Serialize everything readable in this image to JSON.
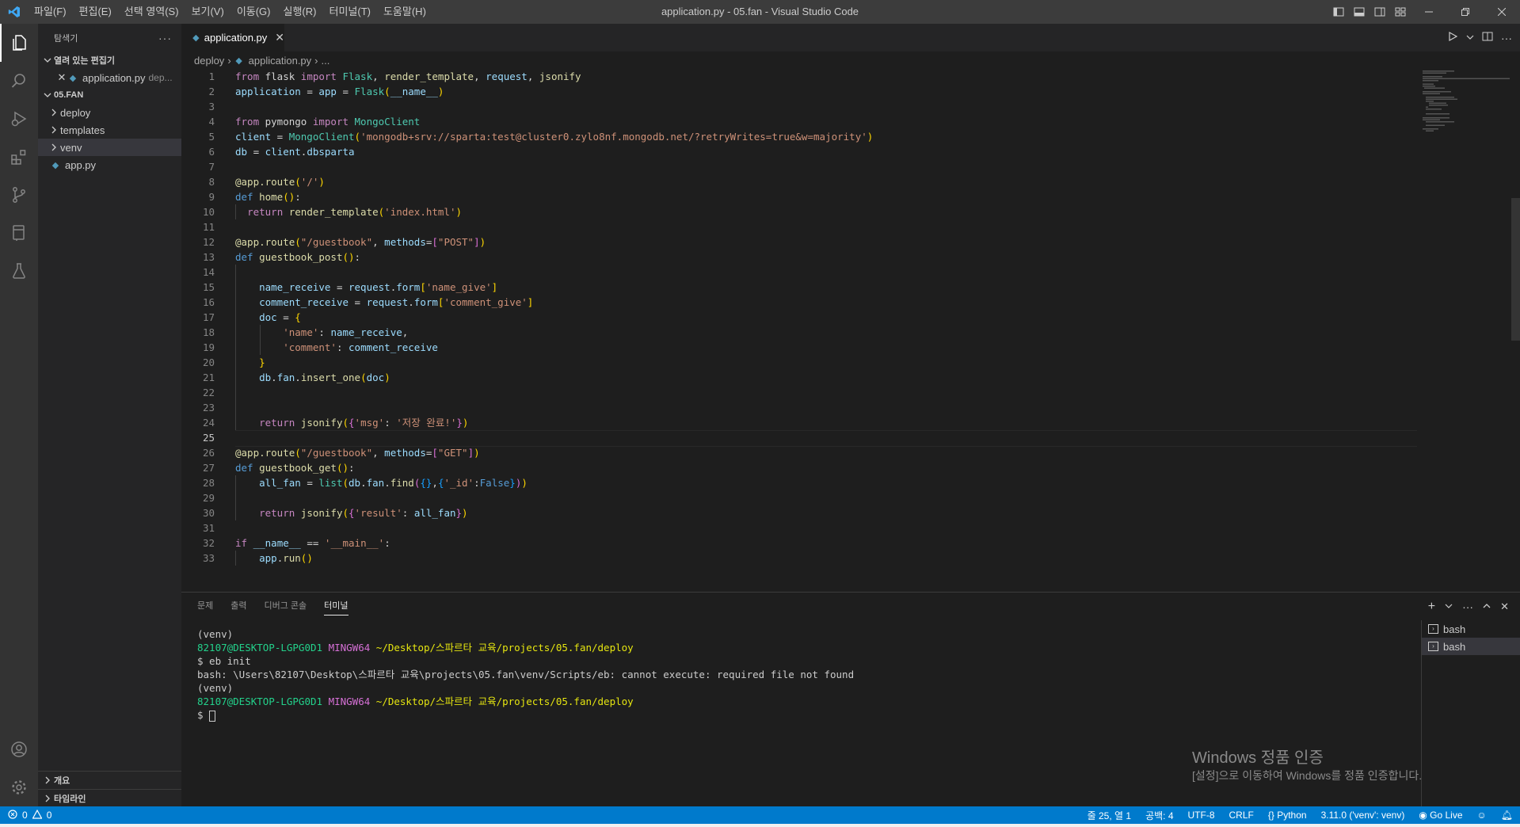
{
  "titlebar": {
    "menu": [
      "파일(F)",
      "편집(E)",
      "선택 영역(S)",
      "보기(V)",
      "이동(G)",
      "실행(R)",
      "터미널(T)",
      "도움말(H)"
    ],
    "window_title": "application.py - 05.fan - Visual Studio Code",
    "colors": {
      "background": "#3c3c3c",
      "logo": "#3fa8f4"
    }
  },
  "activitybar": {
    "items": [
      "explorer-icon",
      "search-icon",
      "run-debug-icon",
      "extensions-icon",
      "source-control-icon",
      "remote-explorer-icon",
      "testing-icon"
    ],
    "bottom": [
      "account-icon",
      "manage-gear-icon"
    ]
  },
  "sidebar": {
    "title": "탐색기",
    "open_editors_label": "열려 있는 편집기",
    "open_editor": {
      "name": "application.py",
      "description": "dep..."
    },
    "folder_label": "05.FAN",
    "tree": [
      {
        "name": "deploy",
        "type": "folder"
      },
      {
        "name": "templates",
        "type": "folder"
      },
      {
        "name": "venv",
        "type": "folder",
        "selected": true
      },
      {
        "name": "app.py",
        "type": "file"
      }
    ],
    "outline_label": "개요",
    "timeline_label": "타임라인"
  },
  "editor": {
    "tab_label": "application.py",
    "breadcrumb": [
      "deploy",
      "application.py",
      "..."
    ],
    "current_line": 25,
    "lines": [
      [
        [
          "kw",
          "from"
        ],
        [
          "p",
          " flask "
        ],
        [
          "kw",
          "import"
        ],
        [
          "p",
          " "
        ],
        [
          "cls",
          "Flask"
        ],
        [
          "p",
          ", "
        ],
        [
          "fn",
          "render_template"
        ],
        [
          "p",
          ", "
        ],
        [
          "var",
          "request"
        ],
        [
          "p",
          ", "
        ],
        [
          "fn",
          "jsonify"
        ]
      ],
      [
        [
          "var",
          "application"
        ],
        [
          "p",
          " = "
        ],
        [
          "var",
          "app"
        ],
        [
          "p",
          " = "
        ],
        [
          "cls",
          "Flask"
        ],
        [
          "br1",
          "("
        ],
        [
          "var",
          "__name__"
        ],
        [
          "br1",
          ")"
        ]
      ],
      [],
      [
        [
          "kw",
          "from"
        ],
        [
          "p",
          " pymongo "
        ],
        [
          "kw",
          "import"
        ],
        [
          "p",
          " "
        ],
        [
          "cls",
          "MongoClient"
        ]
      ],
      [
        [
          "var",
          "client"
        ],
        [
          "p",
          " = "
        ],
        [
          "cls",
          "MongoClient"
        ],
        [
          "br1",
          "("
        ],
        [
          "str",
          "'mongodb+srv://sparta:test@cluster0.zylo8nf.mongodb.net/?retryWrites=true&w=majority'"
        ],
        [
          "br1",
          ")"
        ]
      ],
      [
        [
          "var",
          "db"
        ],
        [
          "p",
          " = "
        ],
        [
          "var",
          "client"
        ],
        [
          "p",
          "."
        ],
        [
          "var",
          "dbsparta"
        ]
      ],
      [],
      [
        [
          "dec",
          "@app.route"
        ],
        [
          "br1",
          "("
        ],
        [
          "str",
          "'/'"
        ],
        [
          "br1",
          ")"
        ]
      ],
      [
        [
          "kwb",
          "def"
        ],
        [
          "p",
          " "
        ],
        [
          "fn",
          "home"
        ],
        [
          "br1",
          "("
        ],
        [
          "br1",
          ")"
        ],
        [
          "p",
          ":"
        ]
      ],
      [
        [
          "p",
          "  "
        ],
        [
          "kw",
          "return"
        ],
        [
          "p",
          " "
        ],
        [
          "fn",
          "render_template"
        ],
        [
          "br1",
          "("
        ],
        [
          "str",
          "'index.html'"
        ],
        [
          "br1",
          ")"
        ]
      ],
      [],
      [
        [
          "dec",
          "@app.route"
        ],
        [
          "br1",
          "("
        ],
        [
          "str",
          "\"/guestbook\""
        ],
        [
          "p",
          ", "
        ],
        [
          "var",
          "methods"
        ],
        [
          "p",
          "="
        ],
        [
          "br2",
          "["
        ],
        [
          "str",
          "\"POST\""
        ],
        [
          "br2",
          "]"
        ],
        [
          "br1",
          ")"
        ]
      ],
      [
        [
          "kwb",
          "def"
        ],
        [
          "p",
          " "
        ],
        [
          "fn",
          "guestbook_post"
        ],
        [
          "br1",
          "("
        ],
        [
          "br1",
          ")"
        ],
        [
          "p",
          ":"
        ]
      ],
      [],
      [
        [
          "p",
          "    "
        ],
        [
          "var",
          "name_receive"
        ],
        [
          "p",
          " = "
        ],
        [
          "var",
          "request"
        ],
        [
          "p",
          "."
        ],
        [
          "var",
          "form"
        ],
        [
          "br1",
          "["
        ],
        [
          "str",
          "'name_give'"
        ],
        [
          "br1",
          "]"
        ]
      ],
      [
        [
          "p",
          "    "
        ],
        [
          "var",
          "comment_receive"
        ],
        [
          "p",
          " = "
        ],
        [
          "var",
          "request"
        ],
        [
          "p",
          "."
        ],
        [
          "var",
          "form"
        ],
        [
          "br1",
          "["
        ],
        [
          "str",
          "'comment_give'"
        ],
        [
          "br1",
          "]"
        ]
      ],
      [
        [
          "p",
          "    "
        ],
        [
          "var",
          "doc"
        ],
        [
          "p",
          " = "
        ],
        [
          "br1",
          "{"
        ]
      ],
      [
        [
          "p",
          "        "
        ],
        [
          "str",
          "'name'"
        ],
        [
          "p",
          ": "
        ],
        [
          "var",
          "name_receive"
        ],
        [
          "p",
          ","
        ]
      ],
      [
        [
          "p",
          "        "
        ],
        [
          "str",
          "'comment'"
        ],
        [
          "p",
          ": "
        ],
        [
          "var",
          "comment_receive"
        ]
      ],
      [
        [
          "p",
          "    "
        ],
        [
          "br1",
          "}"
        ]
      ],
      [
        [
          "p",
          "    "
        ],
        [
          "var",
          "db"
        ],
        [
          "p",
          "."
        ],
        [
          "var",
          "fan"
        ],
        [
          "p",
          "."
        ],
        [
          "fn",
          "insert_one"
        ],
        [
          "br1",
          "("
        ],
        [
          "var",
          "doc"
        ],
        [
          "br1",
          ")"
        ]
      ],
      [],
      [],
      [
        [
          "p",
          "    "
        ],
        [
          "kw",
          "return"
        ],
        [
          "p",
          " "
        ],
        [
          "fn",
          "jsonify"
        ],
        [
          "br1",
          "("
        ],
        [
          "br2",
          "{"
        ],
        [
          "str",
          "'msg'"
        ],
        [
          "p",
          ": "
        ],
        [
          "str",
          "'저장 완료!'"
        ],
        [
          "br2",
          "}"
        ],
        [
          "br1",
          ")"
        ]
      ],
      [],
      [
        [
          "dec",
          "@app.route"
        ],
        [
          "br1",
          "("
        ],
        [
          "str",
          "\"/guestbook\""
        ],
        [
          "p",
          ", "
        ],
        [
          "var",
          "methods"
        ],
        [
          "p",
          "="
        ],
        [
          "br2",
          "["
        ],
        [
          "str",
          "\"GET\""
        ],
        [
          "br2",
          "]"
        ],
        [
          "br1",
          ")"
        ]
      ],
      [
        [
          "kwb",
          "def"
        ],
        [
          "p",
          " "
        ],
        [
          "fn",
          "guestbook_get"
        ],
        [
          "br1",
          "("
        ],
        [
          "br1",
          ")"
        ],
        [
          "p",
          ":"
        ]
      ],
      [
        [
          "p",
          "    "
        ],
        [
          "var",
          "all_fan"
        ],
        [
          "p",
          " = "
        ],
        [
          "cls",
          "list"
        ],
        [
          "br1",
          "("
        ],
        [
          "var",
          "db"
        ],
        [
          "p",
          "."
        ],
        [
          "var",
          "fan"
        ],
        [
          "p",
          "."
        ],
        [
          "fn",
          "find"
        ],
        [
          "br2",
          "("
        ],
        [
          "br3",
          "{}"
        ],
        [
          "p",
          ","
        ],
        [
          "br3",
          "{"
        ],
        [
          "str",
          "'_id'"
        ],
        [
          "p",
          ":"
        ],
        [
          "kwb",
          "False"
        ],
        [
          "br3",
          "}"
        ],
        [
          "br2",
          ")"
        ],
        [
          "br1",
          ")"
        ]
      ],
      [],
      [
        [
          "p",
          "    "
        ],
        [
          "kw",
          "return"
        ],
        [
          "p",
          " "
        ],
        [
          "fn",
          "jsonify"
        ],
        [
          "br1",
          "("
        ],
        [
          "br2",
          "{"
        ],
        [
          "str",
          "'result'"
        ],
        [
          "p",
          ": "
        ],
        [
          "var",
          "all_fan"
        ],
        [
          "br2",
          "}"
        ],
        [
          "br1",
          ")"
        ]
      ],
      [],
      [
        [
          "kw",
          "if"
        ],
        [
          "p",
          " "
        ],
        [
          "var",
          "__name__"
        ],
        [
          "p",
          " == "
        ],
        [
          "str",
          "'__main__'"
        ],
        [
          "p",
          ":"
        ]
      ],
      [
        [
          "p",
          "    "
        ],
        [
          "var",
          "app"
        ],
        [
          "p",
          "."
        ],
        [
          "fn",
          "run"
        ],
        [
          "br1",
          "("
        ],
        [
          "br1",
          ")"
        ]
      ]
    ]
  },
  "panel": {
    "tabs": [
      "문제",
      "출력",
      "디버그 콘솔",
      "터미널"
    ],
    "active_tab": "터미널",
    "terminal": {
      "venv": "(venv)",
      "user": "82107@DESKTOP-LGPG0D1",
      "shell": "MINGW64",
      "path": "~/Desktop/스파르타 교육/projects/05.fan/deploy",
      "command": "$ eb init",
      "error": "bash: \\Users\\82107\\Desktop\\스파르타 교육\\projects\\05.fan\\venv/Scripts/eb: cannot execute: required file not found",
      "prompt": "$ "
    },
    "terminal_list": [
      "bash",
      "bash"
    ]
  },
  "activation_notice": {
    "title": "Windows 정품 인증",
    "subtitle": "[설정]으로 이동하여 Windows를 정품 인증합니다."
  },
  "statusbar": {
    "errors": "0",
    "warnings": "0",
    "position": "줄 25, 열 1",
    "spaces": "공백: 4",
    "encoding": "UTF-8",
    "eol": "CRLF",
    "language": "Python",
    "interpreter": "3.11.0 ('venv': venv)",
    "golive": "Go Live",
    "color": "#007acc"
  }
}
